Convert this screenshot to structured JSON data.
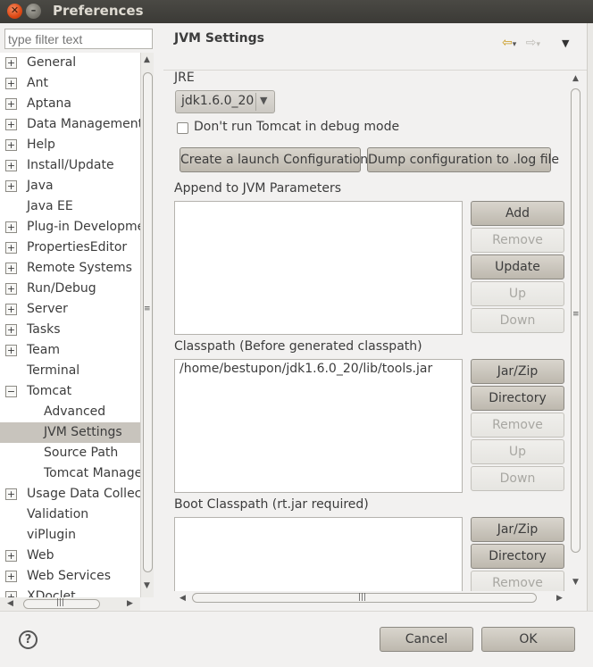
{
  "window": {
    "title": "Preferences",
    "close_glyph": "✕",
    "minimize_glyph": "–"
  },
  "filter": {
    "placeholder": "type filter text"
  },
  "tree": {
    "items": [
      {
        "label": "General",
        "expandable": true
      },
      {
        "label": "Ant",
        "expandable": true
      },
      {
        "label": "Aptana",
        "expandable": true
      },
      {
        "label": "Data Management",
        "expandable": true
      },
      {
        "label": "Help",
        "expandable": true
      },
      {
        "label": "Install/Update",
        "expandable": true
      },
      {
        "label": "Java",
        "expandable": true
      },
      {
        "label": "Java EE",
        "expandable": false
      },
      {
        "label": "Plug-in Developme",
        "expandable": true
      },
      {
        "label": "PropertiesEditor",
        "expandable": true
      },
      {
        "label": "Remote Systems",
        "expandable": true
      },
      {
        "label": "Run/Debug",
        "expandable": true
      },
      {
        "label": "Server",
        "expandable": true
      },
      {
        "label": "Tasks",
        "expandable": true
      },
      {
        "label": "Team",
        "expandable": true
      },
      {
        "label": "Terminal",
        "expandable": false
      },
      {
        "label": "Tomcat",
        "expandable": true,
        "expanded": true
      },
      {
        "label": "Advanced",
        "child": true
      },
      {
        "label": "JVM Settings",
        "child": true,
        "selected": true
      },
      {
        "label": "Source Path",
        "child": true
      },
      {
        "label": "Tomcat Manager",
        "child": true
      },
      {
        "label": "Usage Data Collect",
        "expandable": true
      },
      {
        "label": "Validation",
        "expandable": false
      },
      {
        "label": "viPlugin",
        "expandable": false
      },
      {
        "label": "Web",
        "expandable": true
      },
      {
        "label": "Web Services",
        "expandable": true
      },
      {
        "label": "XDoclet",
        "expandable": true
      }
    ],
    "expand_glyph": "+",
    "collapse_glyph": "−"
  },
  "page": {
    "title": "JVM Settings",
    "back_glyph": "⇦",
    "forward_glyph": "⇨",
    "menu_glyph": "▼",
    "dropdown_glyph": "▾",
    "jre_label": "JRE",
    "jre_value": "jdk1.6.0_20",
    "debug_checkbox_label": "Don't run Tomcat in debug mode",
    "debug_checked": false,
    "create_launch_button": "Create a launch Configuration",
    "dump_config_button": "Dump configuration to .log file",
    "jvm_params": {
      "label": "Append to JVM Parameters",
      "items": [],
      "buttons": {
        "add": "Add",
        "remove": "Remove",
        "update": "Update",
        "up": "Up",
        "down": "Down"
      }
    },
    "classpath": {
      "label": "Classpath (Before generated classpath)",
      "items": [
        "/home/bestupon/jdk1.6.0_20/lib/tools.jar"
      ],
      "buttons": {
        "jarzip": "Jar/Zip",
        "directory": "Directory",
        "remove": "Remove",
        "up": "Up",
        "down": "Down"
      }
    },
    "boot_classpath": {
      "label": "Boot Classpath (rt.jar required)",
      "items": [],
      "buttons": {
        "jarzip": "Jar/Zip",
        "directory": "Directory",
        "remove": "Remove"
      }
    }
  },
  "footer": {
    "help_glyph": "?",
    "cancel": "Cancel",
    "ok": "OK"
  },
  "scroll_glyphs": {
    "up": "▲",
    "down": "▼",
    "left": "◀",
    "right": "▶",
    "grip_v": "≡",
    "grip_h": "|||"
  }
}
